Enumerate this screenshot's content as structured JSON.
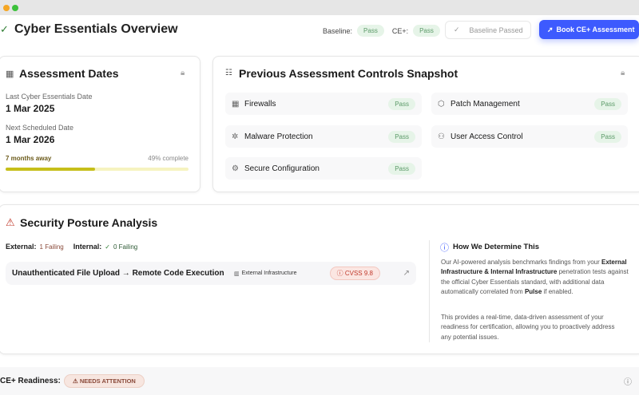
{
  "header": {
    "title": "Cyber Essentials Overview",
    "baseline_label": "Baseline:",
    "baseline_status": "Pass",
    "ceplus_label": "CE+:",
    "ceplus_status": "Pass",
    "baseline_passed": "Baseline Passed",
    "book_button": "Book CE+ Assessment"
  },
  "dates": {
    "title": "Assessment Dates",
    "last_label": "Last Cyber Essentials Date",
    "last_value": "1 Mar 2025",
    "next_label": "Next Scheduled Date",
    "next_value": "1 Mar 2026",
    "away": "7 months away",
    "complete_text": "49% complete",
    "progress": 49
  },
  "controls": {
    "title": "Previous Assessment Controls Snapshot",
    "items": [
      {
        "label": "Firewalls",
        "status": "Pass",
        "icon": "firewall-icon"
      },
      {
        "label": "Patch Management",
        "status": "Pass",
        "icon": "package-icon"
      },
      {
        "label": "Malware Protection",
        "status": "Pass",
        "icon": "bug-icon"
      },
      {
        "label": "User Access Control",
        "status": "Pass",
        "icon": "users-icon"
      },
      {
        "label": "Secure Configuration",
        "status": "Pass",
        "icon": "gear-icon"
      }
    ]
  },
  "posture": {
    "title": "Security Posture Analysis",
    "external_label": "External:",
    "external_value": "1 Failing",
    "internal_label": "Internal:",
    "internal_value": "0 Failing",
    "finding": {
      "title": "Unauthenticated File Upload → Remote Code Execution",
      "scope": "External Infrastructure",
      "cvss": "CVSS 9.8"
    },
    "info": {
      "title": "How We Determine This",
      "p1a": "Our AI-powered analysis benchmarks findings from your ",
      "p1b": "External Infrastructure & Internal Infrastructure",
      "p1c": " penetration tests against the official Cyber Essentials standard, with additional data automatically correlated from ",
      "p1d": "Pulse",
      "p1e": " if enabled.",
      "p2": "This provides a real-time, data-driven assessment of your readiness for certification, allowing you to proactively address any potential issues."
    }
  },
  "readiness": {
    "label": "CE+ Readiness:",
    "status": "NEEDS ATTENTION"
  },
  "colors": {
    "accent": "#3d5afe",
    "pass_bg": "#e6f4e8",
    "pass_fg": "#5b9a68",
    "progress": "#c6bf1a",
    "danger": "#c0392b"
  }
}
